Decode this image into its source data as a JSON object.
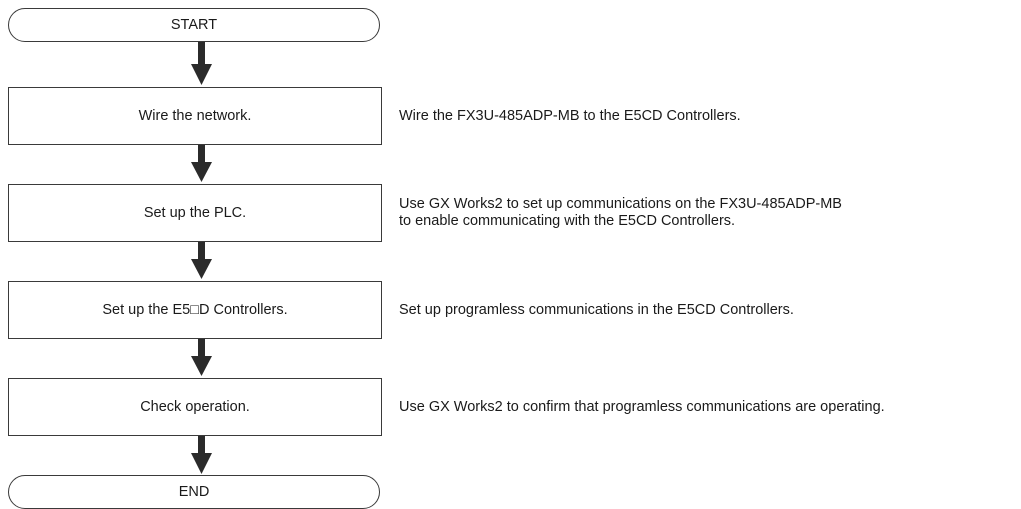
{
  "flowchart": {
    "start_label": "START",
    "end_label": "END",
    "steps": [
      {
        "label": "Wire the network.",
        "description": [
          "Wire the FX3U-485ADP-MB to the E5CD Controllers."
        ]
      },
      {
        "label": "Set up the PLC.",
        "description": [
          "Use GX Works2 to set up communications on the FX3U-485ADP-MB",
          "to enable communicating with the E5CD Controllers."
        ]
      },
      {
        "label": "Set up the E5□D Controllers.",
        "description": [
          "Set up programless communications in the E5CD Controllers."
        ]
      },
      {
        "label": "Check operation.",
        "description": [
          "Use GX Works2 to confirm that programless communications are operating."
        ]
      }
    ]
  }
}
